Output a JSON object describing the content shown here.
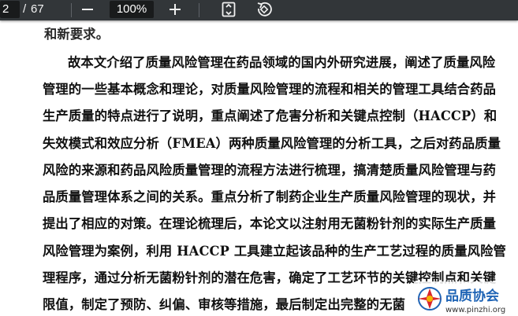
{
  "toolbar": {
    "current_page": "2",
    "page_separator": "/",
    "total_pages": "67",
    "zoom_level": "100%",
    "zoom_out_icon": "minus-icon",
    "zoom_in_icon": "plus-icon",
    "fit_icon": "fit-to-page-icon",
    "rotate_icon": "rotate-icon"
  },
  "document": {
    "partial_top_line": "和新要求。",
    "lines": [
      "故本文介绍了质量风险管理在药品领域的国内外研究进展，阐述了质量风险",
      "管理的一些基本概念和理论，对质量风险管理的流程和相关的管理工具结合药品",
      "生产质量的特点进行了说明，重点阐述了危害分析和关键点控制（HACCP）和",
      "失效模式和效应分析（FMEA）两种质量风险管理的分析工具，之后对药品质量",
      "风险的来源和药品风险质量管理的流程方法进行梳理，搞清楚质量风险管理与药",
      "品质量管理体系之间的关系。重点分析了制药企业生产质量风险管理的现状，并",
      "提出了相应的对策。在理论梳理后，本论文以注射用无菌粉针剂的实际生产质量",
      "风险管理为案例，利用 HACCP 工具建立起该品种的生产工艺过程的质量风险管",
      "理程序，通过分析无菌粉针剂的潜在危害，确定了工艺环节的关键控制点和关键",
      "限值，制定了预防、纠偏、审核等措施，最后制定出完整的无菌"
    ]
  },
  "watermark": {
    "logo_text": "品质协会",
    "logo_url_text": "www.pinzhi.org"
  },
  "colors": {
    "toolbar_bg": "#323639",
    "field_bg": "#191b1c",
    "text": "#111111",
    "logo_red": "#d9262c",
    "logo_blue": "#1f64b5"
  }
}
